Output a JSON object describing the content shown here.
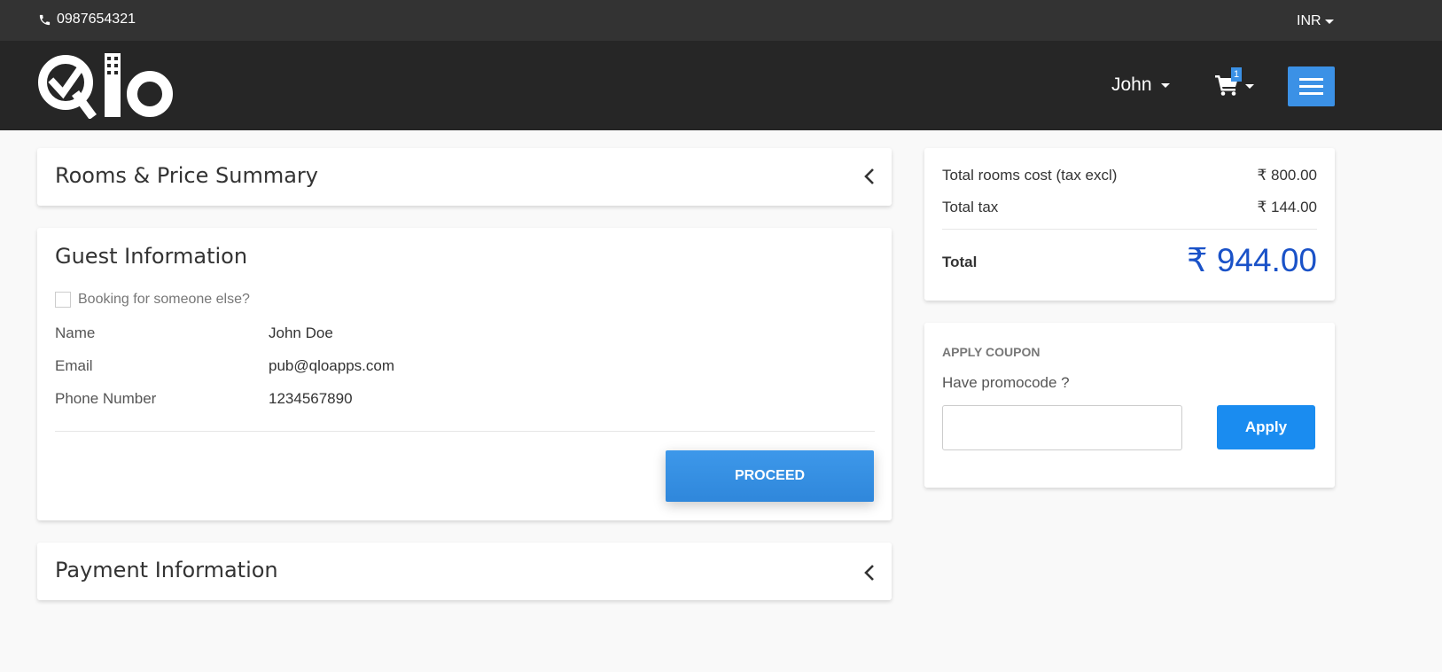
{
  "topbar": {
    "phone": "0987654321",
    "currency": "INR"
  },
  "header": {
    "user": "John",
    "cart_count": "1"
  },
  "rooms_summary": {
    "title": "Rooms & Price Summary"
  },
  "guest": {
    "title": "Guest Information",
    "booking_other_label": "Booking for someone else?",
    "fields": [
      {
        "label": "Name",
        "value": "John Doe"
      },
      {
        "label": "Email",
        "value": "pub@qloapps.com"
      },
      {
        "label": "Phone Number",
        "value": "1234567890"
      }
    ],
    "proceed_label": "PROCEED"
  },
  "payment": {
    "title": "Payment Information"
  },
  "summary": {
    "rooms_cost_label": "Total rooms cost (tax excl)",
    "rooms_cost_value": "₹ 800.00",
    "tax_label": "Total tax",
    "tax_value": "₹ 144.00",
    "total_label": "Total",
    "total_value": "₹ 944.00"
  },
  "coupon": {
    "title": "APPLY COUPON",
    "subtitle": "Have promocode ?",
    "input_value": "",
    "apply_label": "Apply"
  },
  "colors": {
    "accent": "#3b91e6",
    "total": "#1a52c8",
    "header_bg": "#262626",
    "topbar_bg": "#333333"
  }
}
